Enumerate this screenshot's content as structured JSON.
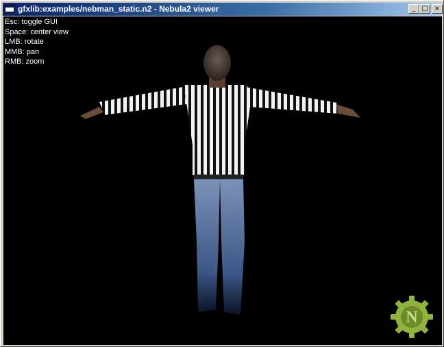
{
  "window": {
    "title": "gfxlib:examples/nebman_static.n2 - Nebula2 viewer",
    "icon": "app-window-icon",
    "controls": {
      "minimize": "_",
      "maximize": "□",
      "close": "×"
    }
  },
  "help_overlay": [
    "Esc: toggle GUI",
    "Space: center view",
    "LMB: rotate",
    "MMB: pan",
    "RMB: zoom"
  ],
  "scene": {
    "model": "nebman-character",
    "shirt": "black-and-white striped referee shirt",
    "pants": "blue jeans",
    "background": "#000000"
  },
  "logo": {
    "icon": "nebula-gear-logo-icon",
    "letter": "N",
    "color": "#8fb33c"
  }
}
